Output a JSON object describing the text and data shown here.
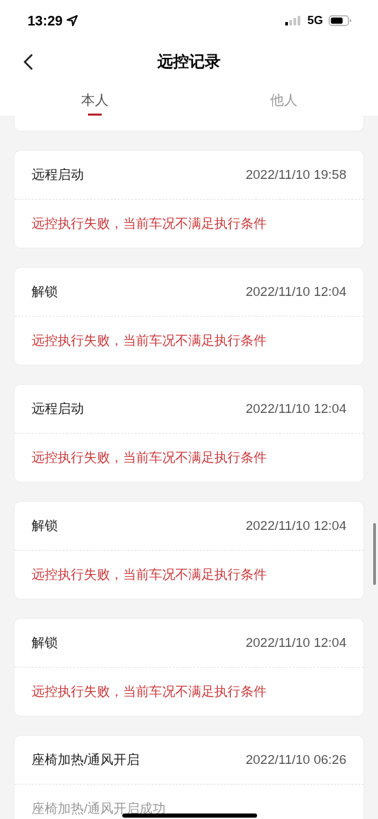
{
  "status_bar": {
    "time": "13:29",
    "network": "5G"
  },
  "nav": {
    "title": "远控记录"
  },
  "tabs": [
    {
      "label": "本人",
      "selected": true
    },
    {
      "label": "他人",
      "selected": false
    }
  ],
  "records": [
    {
      "action": "远程启动",
      "time": "2022/11/10 19:58",
      "message": "远控执行失败，当前车况不满足执行条件",
      "success": false
    },
    {
      "action": "解锁",
      "time": "2022/11/10 12:04",
      "message": "远控执行失败，当前车况不满足执行条件",
      "success": false
    },
    {
      "action": "远程启动",
      "time": "2022/11/10 12:04",
      "message": "远控执行失败，当前车况不满足执行条件",
      "success": false
    },
    {
      "action": "解锁",
      "time": "2022/11/10 12:04",
      "message": "远控执行失败，当前车况不满足执行条件",
      "success": false
    },
    {
      "action": "解锁",
      "time": "2022/11/10 12:04",
      "message": "远控执行失败，当前车况不满足执行条件",
      "success": false
    },
    {
      "action": "座椅加热/通风开启",
      "time": "2022/11/10 06:26",
      "message": "座椅加热/通风开启成功",
      "success": true
    }
  ]
}
